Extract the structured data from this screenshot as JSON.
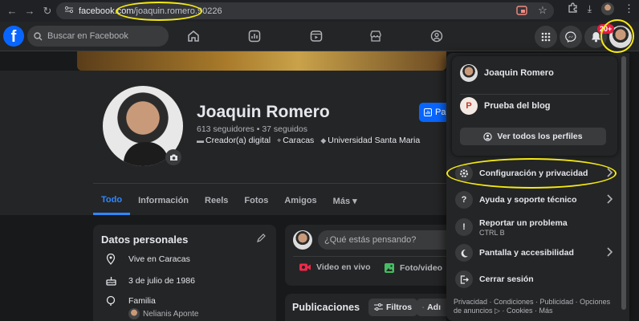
{
  "browser": {
    "url_domain": "facebook.com",
    "url_path": "/joaquin.romero.90226"
  },
  "topbar": {
    "search_placeholder": "Buscar en Facebook",
    "notifications_badge": "20+"
  },
  "profile": {
    "name": "Joaquin Romero",
    "followers": "613 seguidores • 37 seguidos",
    "meta": [
      "Creador(a) digital",
      "Caracas",
      "Universidad Santa Maria"
    ],
    "pro_button_partial": "Pa",
    "tabs": [
      "Todo",
      "Información",
      "Reels",
      "Fotos",
      "Amigos",
      "Más ▾"
    ]
  },
  "details": {
    "title": "Datos personales",
    "lives": "Vive en Caracas",
    "birthday": "3 de julio de 1986",
    "family_label": "Familia",
    "family_member": "Nelianis Aponte"
  },
  "composer": {
    "placeholder": "¿Qué estás pensando?",
    "live_video": "Video en vivo",
    "photo_video": "Foto/video"
  },
  "posts": {
    "title": "Publicaciones",
    "filters": "Filtros",
    "manage_partial": "Adı"
  },
  "menu": {
    "profile_name": "Joaquin Romero",
    "page_name": "Prueba del blog",
    "see_all": "Ver todos los perfiles",
    "items": [
      {
        "label": "Configuración y privacidad",
        "sub": ""
      },
      {
        "label": "Ayuda y soporte técnico",
        "sub": ""
      },
      {
        "label": "Reportar un problema",
        "sub": "CTRL B"
      },
      {
        "label": "Pantalla y accesibilidad",
        "sub": ""
      },
      {
        "label": "Cerrar sesión",
        "sub": ""
      }
    ],
    "footer": "Privacidad · Condiciones · Publicidad · Opciones de anuncios ▷ · Cookies · Más"
  },
  "colors": {
    "brand": "#0866ff",
    "annotation": "#f5ea13",
    "badge": "#e41e3f"
  }
}
